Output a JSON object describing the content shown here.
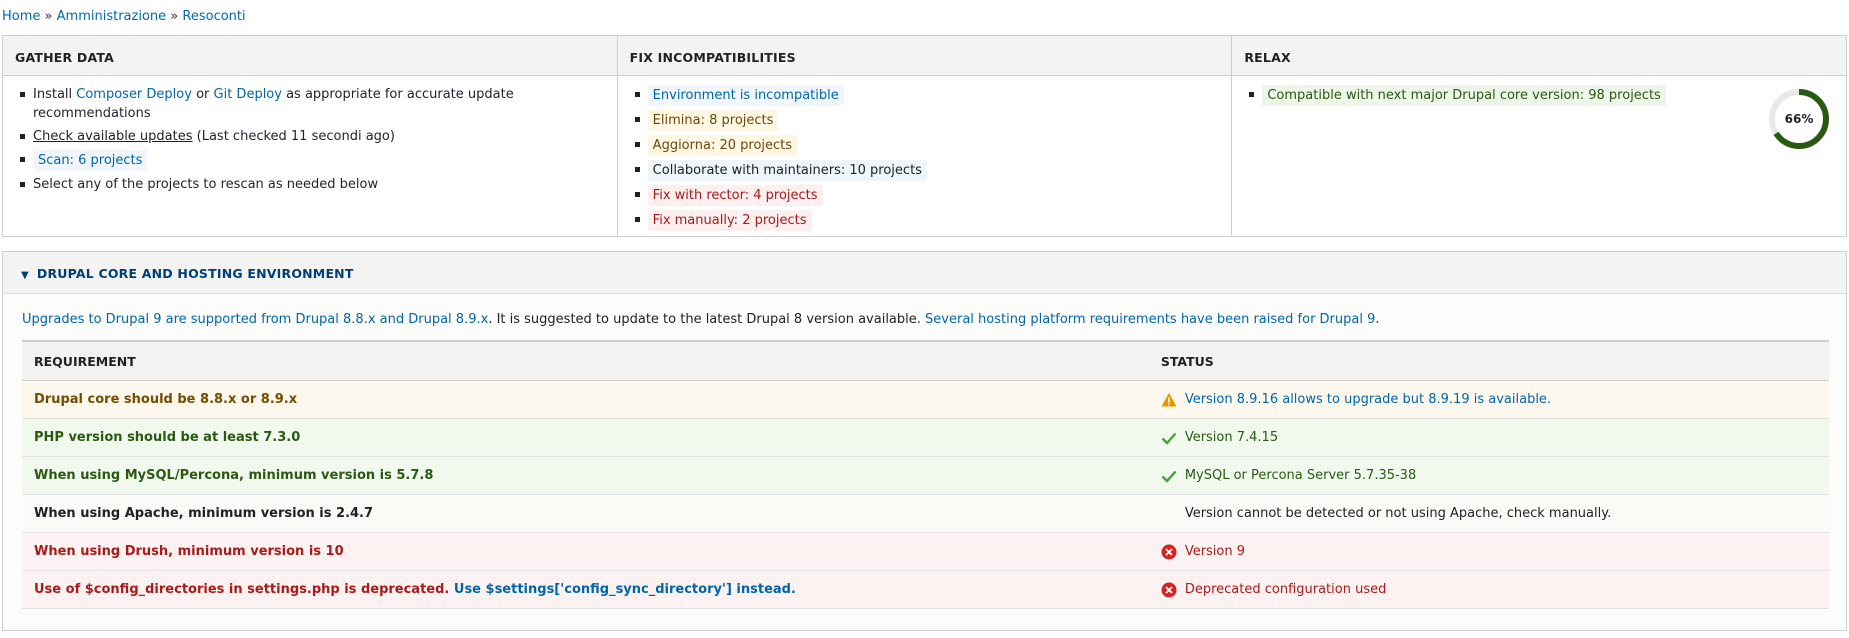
{
  "breadcrumb": {
    "items": [
      "Home",
      "Amministrazione",
      "Resoconti"
    ],
    "separator": "»"
  },
  "summary": {
    "gather": {
      "title": "GATHER DATA",
      "install_prefix": "Install ",
      "composer_deploy": "Composer Deploy",
      "or": " or ",
      "git_deploy": "Git Deploy",
      "install_suffix": " as appropriate for accurate update recommendations",
      "check_updates": "Check available updates",
      "last_checked": " (Last checked 11 secondi ago)",
      "scan": "Scan: 6 projects",
      "select_text": "Select any of the projects to rescan as needed below"
    },
    "fix": {
      "title": "FIX INCOMPATIBILITIES",
      "items": [
        {
          "label": "Environment is incompatible",
          "kind": "info"
        },
        {
          "label": "Elimina: 8 projects",
          "kind": "warn"
        },
        {
          "label": "Aggiorna: 20 projects",
          "kind": "warn"
        },
        {
          "label": "Collaborate with maintainers: 10 projects",
          "kind": "neutral"
        },
        {
          "label": "Fix with rector: 4 projects",
          "kind": "error"
        },
        {
          "label": "Fix manually: 2 projects",
          "kind": "error"
        }
      ]
    },
    "relax": {
      "title": "RELAX",
      "compatible": "Compatible with next major Drupal core version: 98 projects",
      "progress_label": "66%",
      "progress_value": 0.66,
      "progress_color": "#2a5a12",
      "track_color": "#e8e8e8"
    }
  },
  "details": {
    "summary_title": "DRUPAL CORE AND HOSTING ENVIRONMENT",
    "intro_link1": "Upgrades to Drupal 9 are supported from Drupal 8.8.x and Drupal 8.9.x",
    "intro_text": ". It is suggested to update to the latest Drupal 8 version available. ",
    "intro_link2": "Several hosting platform requirements have been raised for Drupal 9",
    "intro_end": ".",
    "table": {
      "headers": [
        "REQUIREMENT",
        "STATUS"
      ],
      "rows": [
        {
          "requirement": "Drupal core should be 8.8.x or 8.9.x",
          "status": "Version 8.9.16 allows to upgrade but 8.9.19 is available.",
          "state": "warn",
          "icon": "warning-icon"
        },
        {
          "requirement": "PHP version should be at least 7.3.0",
          "status": "Version 7.4.15",
          "state": "ok",
          "icon": "checkmark-icon"
        },
        {
          "requirement": "When using MySQL/Percona, minimum version is 5.7.8",
          "status": "MySQL or Percona Server 5.7.35-38",
          "state": "ok",
          "icon": "checkmark-icon"
        },
        {
          "requirement": "When using Apache, minimum version is 2.4.7",
          "status": "Version cannot be detected or not using Apache, check manually.",
          "state": "plain",
          "icon": ""
        },
        {
          "requirement": "When using Drush, minimum version is 10",
          "status": "Version 9",
          "state": "err",
          "icon": "error-icon"
        },
        {
          "requirement": "Use of $config_directories in settings.php is deprecated.",
          "requirement_link": "Use $settings['config_sync_directory'] instead.",
          "status": "Deprecated configuration used",
          "state": "err",
          "icon": "error-icon"
        }
      ]
    }
  }
}
